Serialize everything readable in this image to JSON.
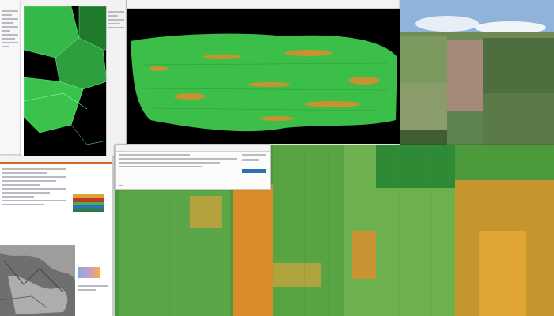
{
  "windows": {
    "vector_map": {
      "title": "",
      "status": ""
    },
    "crop_map": {
      "title": ""
    },
    "aerial": {
      "title": ""
    },
    "report": {
      "title": "",
      "legend_colors": [
        "#d9a337",
        "#c0392b",
        "#4caf50",
        "#2f6fb5",
        "#2e7d32"
      ]
    },
    "dialog": {
      "title": "",
      "ok_label": ""
    },
    "large_map": {
      "title": ""
    }
  },
  "colors": {
    "vegetation_green": "#3cbf48",
    "stress_orange": "#e08b2c",
    "background_black": "#000000"
  }
}
